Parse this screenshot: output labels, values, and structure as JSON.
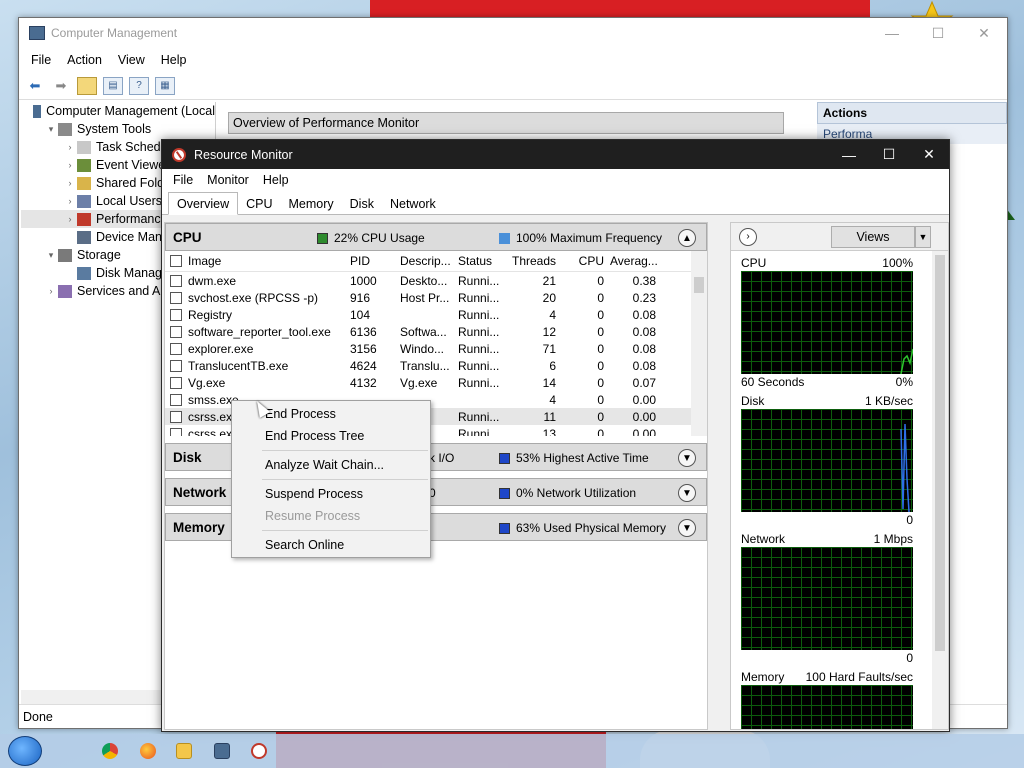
{
  "colors": {
    "cpu_green": "#2e8b2e",
    "freq_blue": "#4a90d9",
    "disk_blue": "#1e46c8",
    "mem_blue": "#1e46c8",
    "graph_line": "#2ec42e"
  },
  "computer_management": {
    "title": "Computer Management",
    "menu": [
      "File",
      "Action",
      "View",
      "Help"
    ],
    "tree": [
      {
        "label": "Computer Management (Local",
        "indent": 0,
        "arrow": ""
      },
      {
        "label": "System Tools",
        "indent": 1,
        "arrow": "v"
      },
      {
        "label": "Task Scheduler",
        "indent": 2,
        "arrow": ">"
      },
      {
        "label": "Event Viewer",
        "indent": 2,
        "arrow": ">"
      },
      {
        "label": "Shared Folders",
        "indent": 2,
        "arrow": ">"
      },
      {
        "label": "Local Users an",
        "indent": 2,
        "arrow": ">"
      },
      {
        "label": "Performance",
        "indent": 2,
        "arrow": ">",
        "selected": true
      },
      {
        "label": "Device Manag",
        "indent": 2,
        "arrow": ""
      },
      {
        "label": "Storage",
        "indent": 1,
        "arrow": "v"
      },
      {
        "label": "Disk Managem",
        "indent": 2,
        "arrow": ""
      },
      {
        "label": "Services and Appl",
        "indent": 1,
        "arrow": ">"
      }
    ],
    "overview_header": "Overview of Performance Monitor",
    "actions_header": "Actions",
    "actions_sub": "Performa",
    "status": "Done"
  },
  "resource_monitor": {
    "title": "Resource Monitor",
    "menu": [
      "File",
      "Monitor",
      "Help"
    ],
    "tabs": [
      "Overview",
      "CPU",
      "Memory",
      "Disk",
      "Network"
    ],
    "active_tab": "Overview",
    "cpu": {
      "name": "CPU",
      "usage": "22% CPU Usage",
      "freq": "100% Maximum Frequency",
      "columns": [
        "Image",
        "PID",
        "Descrip...",
        "Status",
        "Threads",
        "CPU",
        "Averag..."
      ],
      "rows": [
        [
          "dwm.exe",
          "1000",
          "Deskto...",
          "Runni...",
          "21",
          "0",
          "0.38"
        ],
        [
          "svchost.exe (RPCSS -p)",
          "916",
          "Host Pr...",
          "Runni...",
          "20",
          "0",
          "0.23"
        ],
        [
          "Registry",
          "104",
          "",
          "Runni...",
          "4",
          "0",
          "0.08"
        ],
        [
          "software_reporter_tool.exe",
          "6136",
          "Softwa...",
          "Runni...",
          "12",
          "0",
          "0.08"
        ],
        [
          "explorer.exe",
          "3156",
          "Windo...",
          "Runni...",
          "71",
          "0",
          "0.08"
        ],
        [
          "TranslucentTB.exe",
          "4624",
          "Translu...",
          "Runni...",
          "6",
          "0",
          "0.08"
        ],
        [
          "Vg.exe",
          "4132",
          "Vg.exe",
          "Runni...",
          "14",
          "0",
          "0.07"
        ],
        [
          "smss.exe",
          "",
          "",
          "",
          "4",
          "0",
          "0.00"
        ],
        [
          "csrss.exe",
          "",
          "",
          "Runni...",
          "11",
          "0",
          "0.00"
        ],
        [
          "csrss.exe",
          "",
          "",
          "Runni...",
          "13",
          "0",
          "0.00"
        ]
      ]
    },
    "disk": {
      "name": "Disk",
      "stat1": "k I/O",
      "stat2": "53% Highest Active Time"
    },
    "network": {
      "name": "Network",
      "stat1": "0",
      "stat2": "0% Network Utilization"
    },
    "memory": {
      "name": "Memory",
      "stat2": "63% Used Physical Memory"
    },
    "right_pane": {
      "views_label": "Views",
      "graphs": [
        {
          "name": "CPU",
          "top_right": "100%",
          "foot_left": "60 Seconds",
          "foot_right": "0%"
        },
        {
          "name": "Disk",
          "top_right": "1 KB/sec",
          "foot_left": "",
          "foot_right": "0"
        },
        {
          "name": "Network",
          "top_right": "1 Mbps",
          "foot_left": "",
          "foot_right": "0"
        },
        {
          "name": "Memory",
          "top_right": "100 Hard Faults/sec",
          "foot_left": "",
          "foot_right": ""
        }
      ]
    }
  },
  "context_menu": [
    {
      "label": "End Process",
      "enabled": true
    },
    {
      "label": "End Process Tree",
      "enabled": true
    },
    {
      "sep": true
    },
    {
      "label": "Analyze Wait Chain...",
      "enabled": true
    },
    {
      "sep": true
    },
    {
      "label": "Suspend Process",
      "enabled": true
    },
    {
      "label": "Resume Process",
      "enabled": false
    },
    {
      "sep": true
    },
    {
      "label": "Search Online",
      "enabled": true
    }
  ],
  "taskbar": {
    "icons": [
      "chrome-icon",
      "firefox-icon",
      "file-explorer-icon",
      "computer-management-icon",
      "resource-monitor-icon"
    ]
  }
}
